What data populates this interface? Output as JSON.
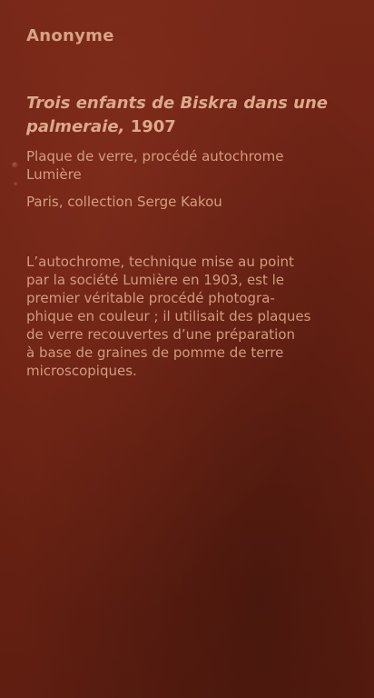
{
  "label": {
    "artist": "Anonyme",
    "title": "Trois enfants de Biskra dans une palmeraie,",
    "year": "1907",
    "medium_lines": [
      "Plaque de verre, procédé autochrome",
      "Lumière"
    ],
    "collection": "Paris, collection Serge Kakou",
    "description_lines": [
      "L’autochrome, technique mise au point",
      "par la société Lumière en 1903, est le",
      "premier véritable procédé photogra-",
      "phique en couleur ; il utilisait des plaques",
      "de verre recouvertes d’une préparation",
      "à base de graines de pomme de terre",
      "microscopiques."
    ]
  },
  "colors": {
    "background": "#6e2314",
    "text": "#d9a487"
  }
}
